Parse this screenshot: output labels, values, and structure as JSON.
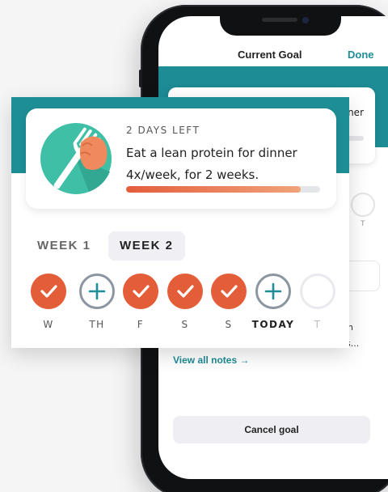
{
  "screen": {
    "title": "Current Goal",
    "done_label": "Done",
    "bg_card_text": "ner",
    "bg_day_label": "T",
    "bg_note_line1": "h",
    "bg_note_line2": "s...",
    "view_notes_label": "View all notes →",
    "cancel_label": "Cancel goal"
  },
  "goal": {
    "days_left": "2 DAYS LEFT",
    "description": "Eat a lean protein for dinner 4x/week, for 2 weeks.",
    "progress": 0.9,
    "icon": "fork-hand-icon"
  },
  "weeks": [
    {
      "label": "WEEK 1",
      "active": false
    },
    {
      "label": "WEEK 2",
      "active": true
    }
  ],
  "days": [
    {
      "label": "W",
      "state": "done"
    },
    {
      "label": "TH",
      "state": "add"
    },
    {
      "label": "F",
      "state": "done"
    },
    {
      "label": "S",
      "state": "done"
    },
    {
      "label": "S",
      "state": "done"
    },
    {
      "label": "TODAY",
      "state": "add"
    },
    {
      "label": "T",
      "state": "empty"
    }
  ],
  "colors": {
    "teal": "#1e8e96",
    "orange": "#e35e38",
    "link": "#1f8c96"
  }
}
